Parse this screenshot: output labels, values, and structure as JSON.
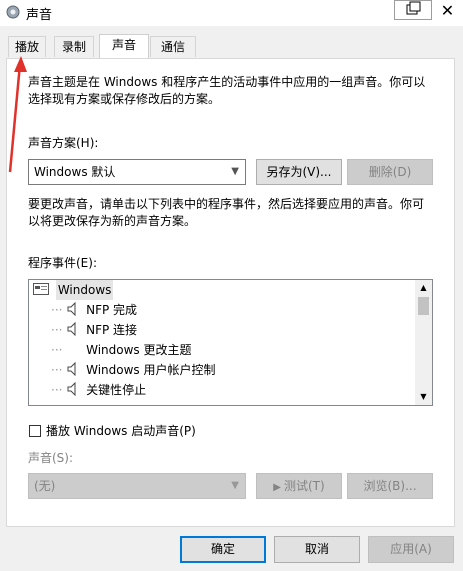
{
  "window": {
    "title": "声音",
    "close_glyph": "✕"
  },
  "tabs": [
    {
      "label": "播放"
    },
    {
      "label": "录制"
    },
    {
      "label": "声音"
    },
    {
      "label": "通信"
    }
  ],
  "intro_line1": "声音主题是在 Windows 和程序产生的活动事件中应用的一组声音。你可以",
  "intro_line2": "选择现有方案或保存修改后的方案。",
  "scheme": {
    "label": "声音方案(H):",
    "value": "Windows 默认",
    "save_as": "另存为(V)...",
    "delete": "删除(D)"
  },
  "instruction_line1": "要更改声音，请单击以下列表中的程序事件，然后选择要应用的声音。你可",
  "instruction_line2": "以将更改保存为新的声音方案。",
  "events": {
    "label": "程序事件(E):",
    "items": [
      {
        "label": "Windows",
        "type": "group"
      },
      {
        "label": "NFP 完成",
        "type": "sound"
      },
      {
        "label": "NFP 连接",
        "type": "sound"
      },
      {
        "label": "Windows 更改主题",
        "type": "none"
      },
      {
        "label": "Windows 用户帐户控制",
        "type": "sound"
      },
      {
        "label": "关键性停止",
        "type": "sound"
      }
    ]
  },
  "startup": {
    "label": "播放 Windows 启动声音(P)",
    "checked": false
  },
  "sound": {
    "label": "声音(S):",
    "value": "(无)",
    "test": "测试(T)",
    "browse": "浏览(B)..."
  },
  "footer": {
    "ok": "确定",
    "cancel": "取消",
    "apply": "应用(A)"
  },
  "colors": {
    "accent": "#0078d7",
    "annotation_arrow": "#e0312b"
  }
}
